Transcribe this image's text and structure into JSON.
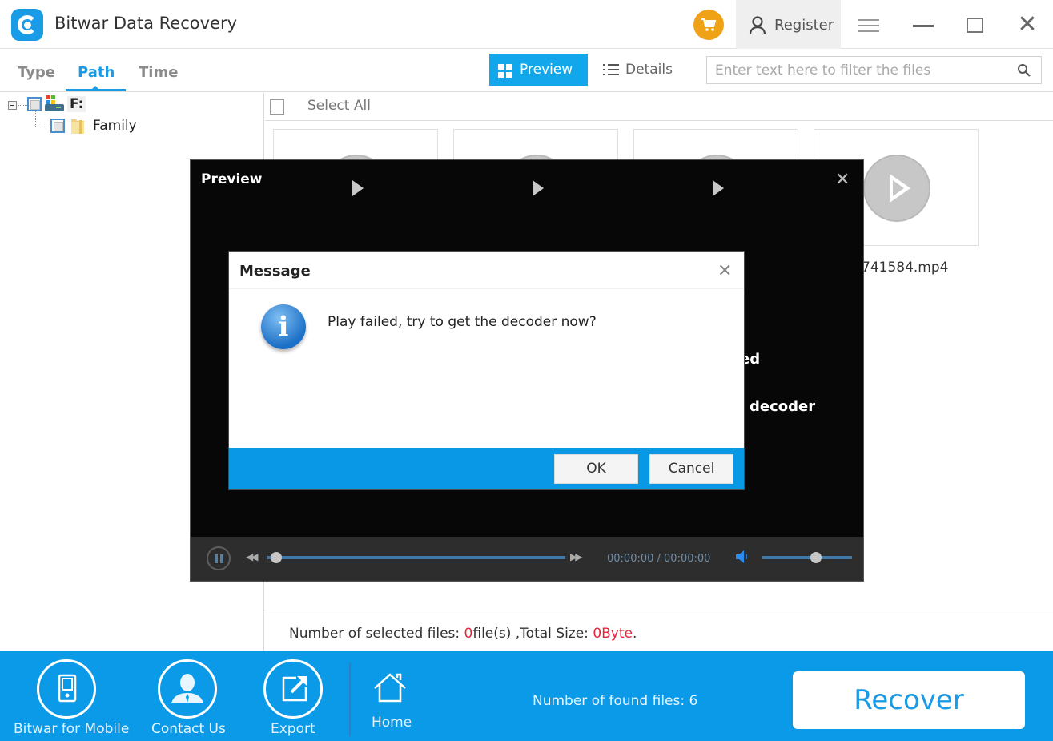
{
  "app": {
    "title": "Bitwar Data Recovery",
    "register_label": "Register"
  },
  "tabs": [
    {
      "label": "Type",
      "active": false
    },
    {
      "label": "Path",
      "active": true
    },
    {
      "label": "Time",
      "active": false
    }
  ],
  "view_toggle": {
    "preview_label": "Preview",
    "details_label": "Details",
    "active": "Preview"
  },
  "search": {
    "placeholder": "Enter text here to filter the files",
    "value": ""
  },
  "tree": {
    "drive": {
      "label": "F:",
      "checked": false,
      "expanded": true
    },
    "folders": [
      {
        "label": "Family",
        "checked": false
      }
    ]
  },
  "file_list": {
    "select_all_label": "Select All",
    "cards": [
      {
        "name": ""
      },
      {
        "name": ""
      },
      {
        "name": ""
      },
      {
        "name": "741584.mp4"
      }
    ]
  },
  "status": {
    "prefix": "Number of selected files: ",
    "file_count": "0",
    "mid": "file(s) ,Total Size: ",
    "size": "0Byte",
    "suffix": "."
  },
  "bottom_bar": {
    "items": [
      {
        "label": "Bitwar for Mobile",
        "icon": "mobile-icon"
      },
      {
        "label": "Contact Us",
        "icon": "contact-icon"
      },
      {
        "label": "Export",
        "icon": "export-icon"
      },
      {
        "label": "Home",
        "icon": "home-icon"
      }
    ],
    "found_files": "Number of found files: 6",
    "recover_label": "Recover"
  },
  "preview_dialog": {
    "title": "Preview",
    "background_text_1": "ed",
    "background_text_2": "decoder",
    "player": {
      "time": "00:00:00 / 00:00:00",
      "progress": 0.03,
      "volume": 0.6
    }
  },
  "message_dialog": {
    "title": "Message",
    "text": "Play failed, try to get the decoder now?",
    "ok_label": "OK",
    "cancel_label": "Cancel"
  },
  "colors": {
    "accent": "#0a9ae8",
    "cart": "#efa215",
    "highlight_red": "#e8253a"
  }
}
